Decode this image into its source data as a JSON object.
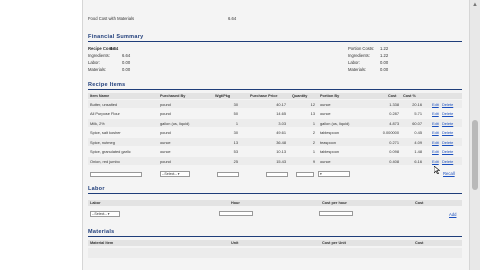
{
  "top_line": {
    "label": "Food Cost with Materials",
    "value": "6.64"
  },
  "financial": {
    "title": "Financial Summary",
    "left": [
      {
        "label": "Recipe Costs:",
        "value": "6.64"
      },
      {
        "label": "Ingredients:",
        "value": "6.64"
      },
      {
        "label": "Labor:",
        "value": "0.00"
      },
      {
        "label": "Materials:",
        "value": "0.00"
      }
    ],
    "right": [
      {
        "label": "Portion Costs:",
        "value": "1.22"
      },
      {
        "label": "Ingredients:",
        "value": "1.22"
      },
      {
        "label": "Labor:",
        "value": "0.00"
      },
      {
        "label": "Materials:",
        "value": "0.00"
      }
    ]
  },
  "recipe_items": {
    "title": "Recipe Items",
    "headers": [
      "Item Name",
      "Purchased By",
      "Wgt/Pkg",
      "Purchase Price",
      "Quantity",
      "Portion By",
      "Cost",
      "Cost %"
    ],
    "rows": [
      {
        "name": "Butter, unsalted",
        "purchased": "pound",
        "wgt": "30",
        "price": "40.17",
        "qty": "12",
        "portion": "ounce",
        "cost": "1.338",
        "pct": "20.16"
      },
      {
        "name": "All Purpose Flour",
        "purchased": "pound",
        "wgt": "50",
        "price": "14.65",
        "qty": "13",
        "portion": "ounce",
        "cost": "0.287",
        "pct": "5.71"
      },
      {
        "name": "Milk, 2%",
        "purchased": "gallon (us, liquid)",
        "wgt": "1",
        "price": "3.03",
        "qty": "1",
        "portion": "gallon (us, liquid)",
        "cost": "4.873",
        "pct": "60.07"
      },
      {
        "name": "Spice, salt kosher",
        "purchased": "pound",
        "wgt": "30",
        "price": "49.61",
        "qty": "2",
        "portion": "tablespoon",
        "cost": "0.000000",
        "pct": "0.45"
      },
      {
        "name": "Spice, nutmeg",
        "purchased": "ounce",
        "wgt": "13",
        "price": "36.48",
        "qty": "2",
        "portion": "teaspoon",
        "cost": "0.271",
        "pct": "4.09"
      },
      {
        "name": "Spice, granulated garlic",
        "purchased": "ounce",
        "wgt": "53",
        "price": "10.13",
        "qty": "1",
        "portion": "tablespoon",
        "cost": "0.098",
        "pct": "1.48"
      },
      {
        "name": "Onion, red jumbo",
        "purchased": "pound",
        "wgt": "25",
        "price": "15.43",
        "qty": "9",
        "portion": "ounce",
        "cost": "0.408",
        "pct": "6.16"
      }
    ],
    "edit_label": "Edit",
    "delete_label": "Delete",
    "add_select": "--Select--",
    "add_label": "Add",
    "recall_label": "Recall"
  },
  "labor": {
    "title": "Labor",
    "headers": [
      "Labor",
      "Hour",
      "Cost per hour",
      "Cost"
    ],
    "select": "--Select--",
    "add_label": "Add"
  },
  "materials": {
    "title": "Materials",
    "headers": [
      "Material Item",
      "Unit",
      "Cost per Unit",
      "Cost"
    ]
  }
}
